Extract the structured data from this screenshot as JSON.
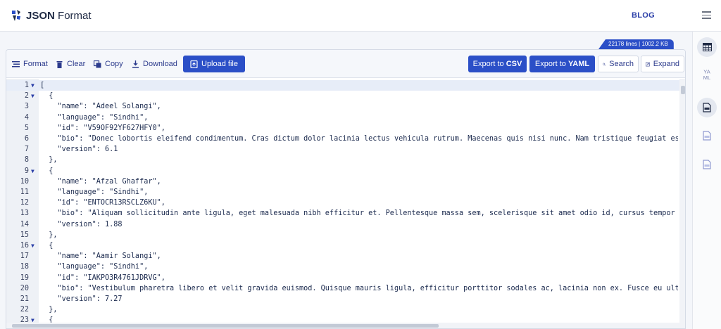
{
  "header": {
    "logo_bold": "JSON",
    "logo_rest": " Format",
    "blog_label": "BLOG"
  },
  "stats": "22178 lines | 1002.2 KB",
  "toolbar": {
    "format": "Format",
    "clear": "Clear",
    "copy": "Copy",
    "download": "Download",
    "upload": "Upload file",
    "export_csv_prefix": "Export to ",
    "export_csv_bold": "CSV",
    "export_yaml_prefix": "Export to ",
    "export_yaml_bold": "YAML",
    "search": "Search",
    "expand": "Expand"
  },
  "right_panel": {
    "yaml_icon_text": "YA\nML"
  },
  "colors": {
    "accent": "#2b4fc7",
    "text_dark": "#1b2a4e",
    "gutter": "#eef1f6"
  },
  "editor": {
    "lines": [
      {
        "n": "1",
        "fold": "▼",
        "text": "["
      },
      {
        "n": "2",
        "fold": "▼",
        "text": "  {"
      },
      {
        "n": "3",
        "fold": "",
        "text": "    \"name\": \"Adeel Solangi\","
      },
      {
        "n": "4",
        "fold": "",
        "text": "    \"language\": \"Sindhi\","
      },
      {
        "n": "5",
        "fold": "",
        "text": "    \"id\": \"V59OF92YF627HFY0\","
      },
      {
        "n": "6",
        "fold": "",
        "text": "    \"bio\": \"Donec lobortis eleifend condimentum. Cras dictum dolor lacinia lectus vehicula rutrum. Maecenas quis nisi nunc. Nam tristique feugiat est vitae"
      },
      {
        "n": "7",
        "fold": "",
        "text": "    \"version\": 6.1"
      },
      {
        "n": "8",
        "fold": "",
        "text": "  },"
      },
      {
        "n": "9",
        "fold": "▼",
        "text": "  {"
      },
      {
        "n": "10",
        "fold": "",
        "text": "    \"name\": \"Afzal Ghaffar\","
      },
      {
        "n": "11",
        "fold": "",
        "text": "    \"language\": \"Sindhi\","
      },
      {
        "n": "12",
        "fold": "",
        "text": "    \"id\": \"ENTOCR13RSCLZ6KU\","
      },
      {
        "n": "13",
        "fold": "",
        "text": "    \"bio\": \"Aliquam sollicitudin ante ligula, eget malesuada nibh efficitur et. Pellentesque massa sem, scelerisque sit amet odio id, cursus tempor urna. E"
      },
      {
        "n": "14",
        "fold": "",
        "text": "    \"version\": 1.88"
      },
      {
        "n": "15",
        "fold": "",
        "text": "  },"
      },
      {
        "n": "16",
        "fold": "▼",
        "text": "  {"
      },
      {
        "n": "17",
        "fold": "",
        "text": "    \"name\": \"Aamir Solangi\","
      },
      {
        "n": "18",
        "fold": "",
        "text": "    \"language\": \"Sindhi\","
      },
      {
        "n": "19",
        "fold": "",
        "text": "    \"id\": \"IAKPO3R4761JDRVG\","
      },
      {
        "n": "20",
        "fold": "",
        "text": "    \"bio\": \"Vestibulum pharetra libero et velit gravida euismod. Quisque mauris ligula, efficitur porttitor sodales ac, lacinia non ex. Fusce eu ultrices e"
      },
      {
        "n": "21",
        "fold": "",
        "text": "    \"version\": 7.27"
      },
      {
        "n": "22",
        "fold": "",
        "text": "  },"
      },
      {
        "n": "23",
        "fold": "▼",
        "text": "  {"
      }
    ]
  }
}
